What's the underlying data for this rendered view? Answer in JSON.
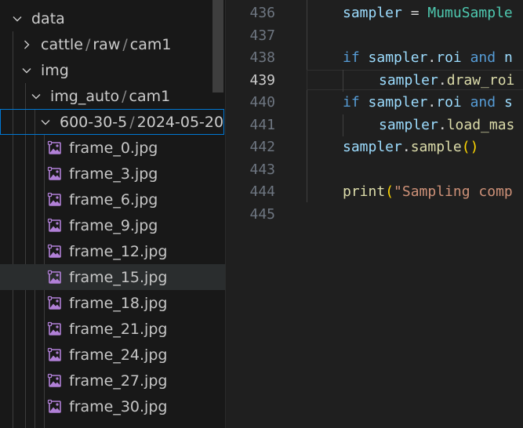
{
  "explorer": {
    "tree": {
      "data": {
        "label": "data"
      },
      "cattle_path": {
        "parts": [
          "cattle",
          "raw",
          "cam1"
        ]
      },
      "img": {
        "label": "img"
      },
      "img_auto_path": {
        "parts": [
          "img_auto",
          "cam1"
        ]
      },
      "session_path": {
        "parts": [
          "600-30-5",
          "2024-05-20..."
        ]
      },
      "files": [
        {
          "name": "frame_0.jpg"
        },
        {
          "name": "frame_3.jpg"
        },
        {
          "name": "frame_6.jpg"
        },
        {
          "name": "frame_9.jpg"
        },
        {
          "name": "frame_12.jpg"
        },
        {
          "name": "frame_15.jpg"
        },
        {
          "name": "frame_18.jpg"
        },
        {
          "name": "frame_21.jpg"
        },
        {
          "name": "frame_24.jpg"
        },
        {
          "name": "frame_27.jpg"
        },
        {
          "name": "frame_30.jpg"
        }
      ]
    },
    "colors": {
      "image_icon": "#b180d7",
      "focus_border": "#0078d4"
    }
  },
  "editor": {
    "active_line": "439",
    "lines": [
      {
        "n": "436",
        "tokens": [
          "sampler",
          " = ",
          "MumuSample"
        ]
      },
      {
        "n": "437",
        "tokens": []
      },
      {
        "n": "438",
        "tokens": [
          "if",
          " sampler",
          ".",
          "roi",
          " ",
          "and",
          " n"
        ]
      },
      {
        "n": "439",
        "tokens": [
          "sampler",
          ".",
          "draw_roi"
        ]
      },
      {
        "n": "440",
        "tokens": [
          "if",
          " sampler",
          ".",
          "roi",
          " ",
          "and",
          " s"
        ]
      },
      {
        "n": "441",
        "tokens": [
          "sampler",
          ".",
          "load_mas"
        ]
      },
      {
        "n": "442",
        "tokens": [
          "sampler",
          ".",
          "sample",
          "()"
        ]
      },
      {
        "n": "443",
        "tokens": []
      },
      {
        "n": "444",
        "tokens": [
          "print",
          "(",
          "\"Sampling comp"
        ]
      },
      {
        "n": "445",
        "tokens": []
      }
    ]
  }
}
